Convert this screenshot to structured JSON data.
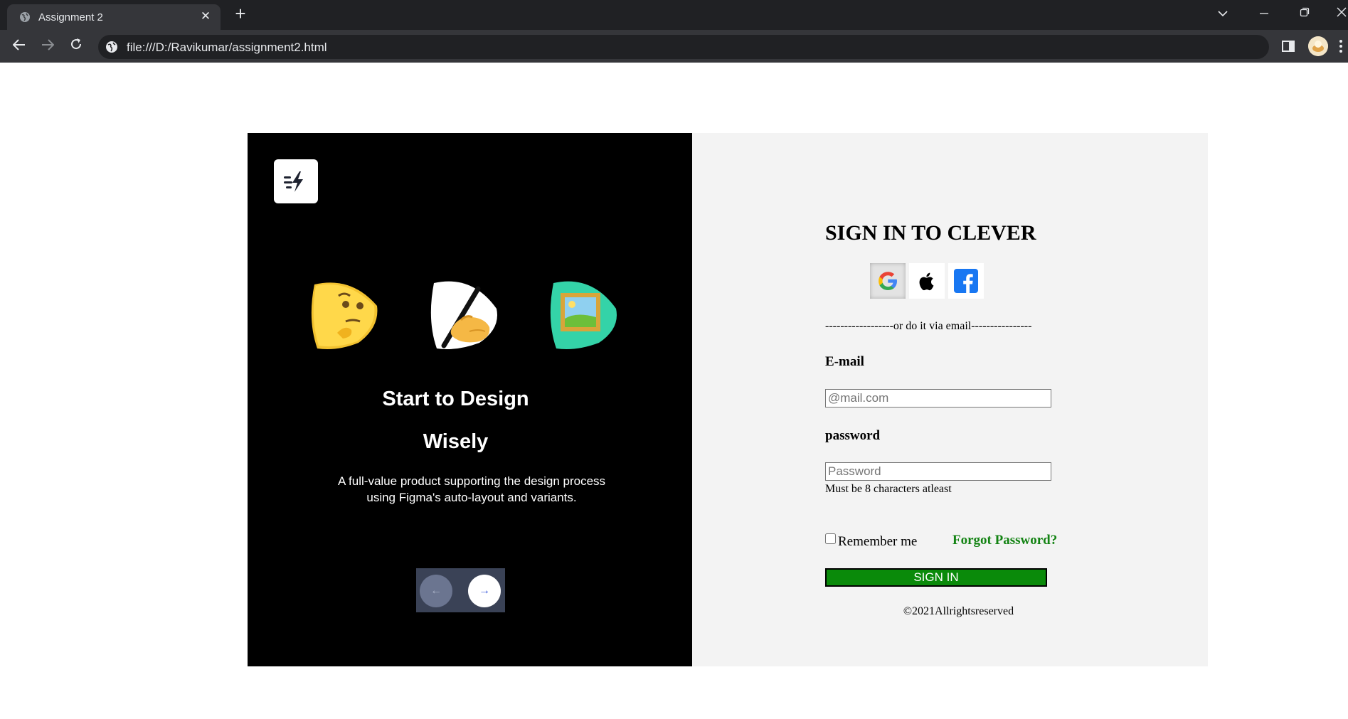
{
  "browser": {
    "tab_title": "Assignment 2",
    "address": "file:///D:/Ravikumar/assignment2.html"
  },
  "hero": {
    "headline_line1": "Start to Design",
    "headline_line2": "Wisely",
    "description_line1": "A full-value product supporting the design process",
    "description_line2": "using Figma's auto-layout and variants.",
    "prev_arrow": "←",
    "next_arrow": "→",
    "emojis": [
      "thinking-face-icon",
      "writing-hand-icon",
      "framed-picture-icon"
    ]
  },
  "signin": {
    "title": "SIGN IN TO CLEVER",
    "social": [
      "google-icon",
      "apple-icon",
      "facebook-icon"
    ],
    "divider": "------------------or do it via email----------------",
    "email_label": "E-mail",
    "email_placeholder": "@mail.com",
    "email_value": "",
    "password_label": "password",
    "password_placeholder": "Password",
    "password_value": "",
    "password_hint": "Must be 8 characters atleast",
    "remember_label": "Remember me",
    "remember_checked": false,
    "forgot_label": "Forgot Password?",
    "button_label": "SIGN IN",
    "copyright": "©2021Allrightsreserved"
  },
  "colors": {
    "left_panel_bg": "#000000",
    "right_panel_bg": "#f3f3f3",
    "sign_in_button": "#0a8a0a",
    "forgot_link": "#138313"
  }
}
